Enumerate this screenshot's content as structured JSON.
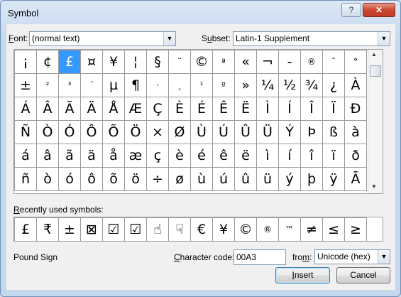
{
  "window": {
    "title": "Symbol",
    "help_label": "?",
    "close_label": "✕"
  },
  "font_row": {
    "font_accel": "F",
    "font_rest": "ont:",
    "font_value": "(normal text)",
    "subset_pre": "S",
    "subset_accel": "u",
    "subset_rest": "bset:",
    "subset_value": "Latin-1 Supplement",
    "dropdown_glyph": "▼"
  },
  "symbol_grid": {
    "rows": [
      [
        "¡",
        "¢",
        "£",
        "¤",
        "¥",
        "¦",
        "§",
        "¨",
        "©",
        "ª",
        "«",
        "¬",
        "-",
        "®",
        "¯",
        "°"
      ],
      [
        "±",
        "²",
        "³",
        "´",
        "µ",
        "¶",
        "·",
        "¸",
        "¹",
        "º",
        "»",
        "¼",
        "½",
        "¾",
        "¿",
        "À"
      ],
      [
        "Á",
        "Â",
        "Ã",
        "Ä",
        "Å",
        "Æ",
        "Ç",
        "È",
        "É",
        "Ê",
        "Ë",
        "Ì",
        "Í",
        "Î",
        "Ï",
        "Ð"
      ],
      [
        "Ñ",
        "Ò",
        "Ó",
        "Ô",
        "Õ",
        "Ö",
        "×",
        "Ø",
        "Ù",
        "Ú",
        "Û",
        "Ü",
        "Ý",
        "Þ",
        "ß",
        "à"
      ],
      [
        "á",
        "â",
        "ã",
        "ä",
        "å",
        "æ",
        "ç",
        "è",
        "é",
        "ê",
        "ë",
        "ì",
        "í",
        "î",
        "ï",
        "ð"
      ],
      [
        "ñ",
        "ò",
        "ó",
        "ô",
        "õ",
        "ö",
        "÷",
        "ø",
        "ù",
        "ú",
        "û",
        "ü",
        "ý",
        "þ",
        "ÿ",
        "Ā"
      ]
    ],
    "selected": "£",
    "scroll_up": "▲",
    "scroll_down": "▼"
  },
  "recent": {
    "label_accel": "R",
    "label_rest": "ecently used symbols:",
    "symbols": [
      "£",
      "₹",
      "±",
      "⊠",
      "☑",
      "☑",
      "☝",
      "☟",
      "€",
      "¥",
      "©",
      "®",
      "™",
      "≠",
      "≤",
      "≥"
    ]
  },
  "info": {
    "symbol_name": "Pound Sign",
    "code_accel": "C",
    "code_rest": "haracter code:",
    "code_value": "00A3",
    "from_pre": "fro",
    "from_accel": "m",
    "from_rest": ":",
    "from_value": "Unicode (hex)"
  },
  "buttons": {
    "insert_accel": "I",
    "insert_rest": "nsert",
    "cancel": "Cancel"
  }
}
